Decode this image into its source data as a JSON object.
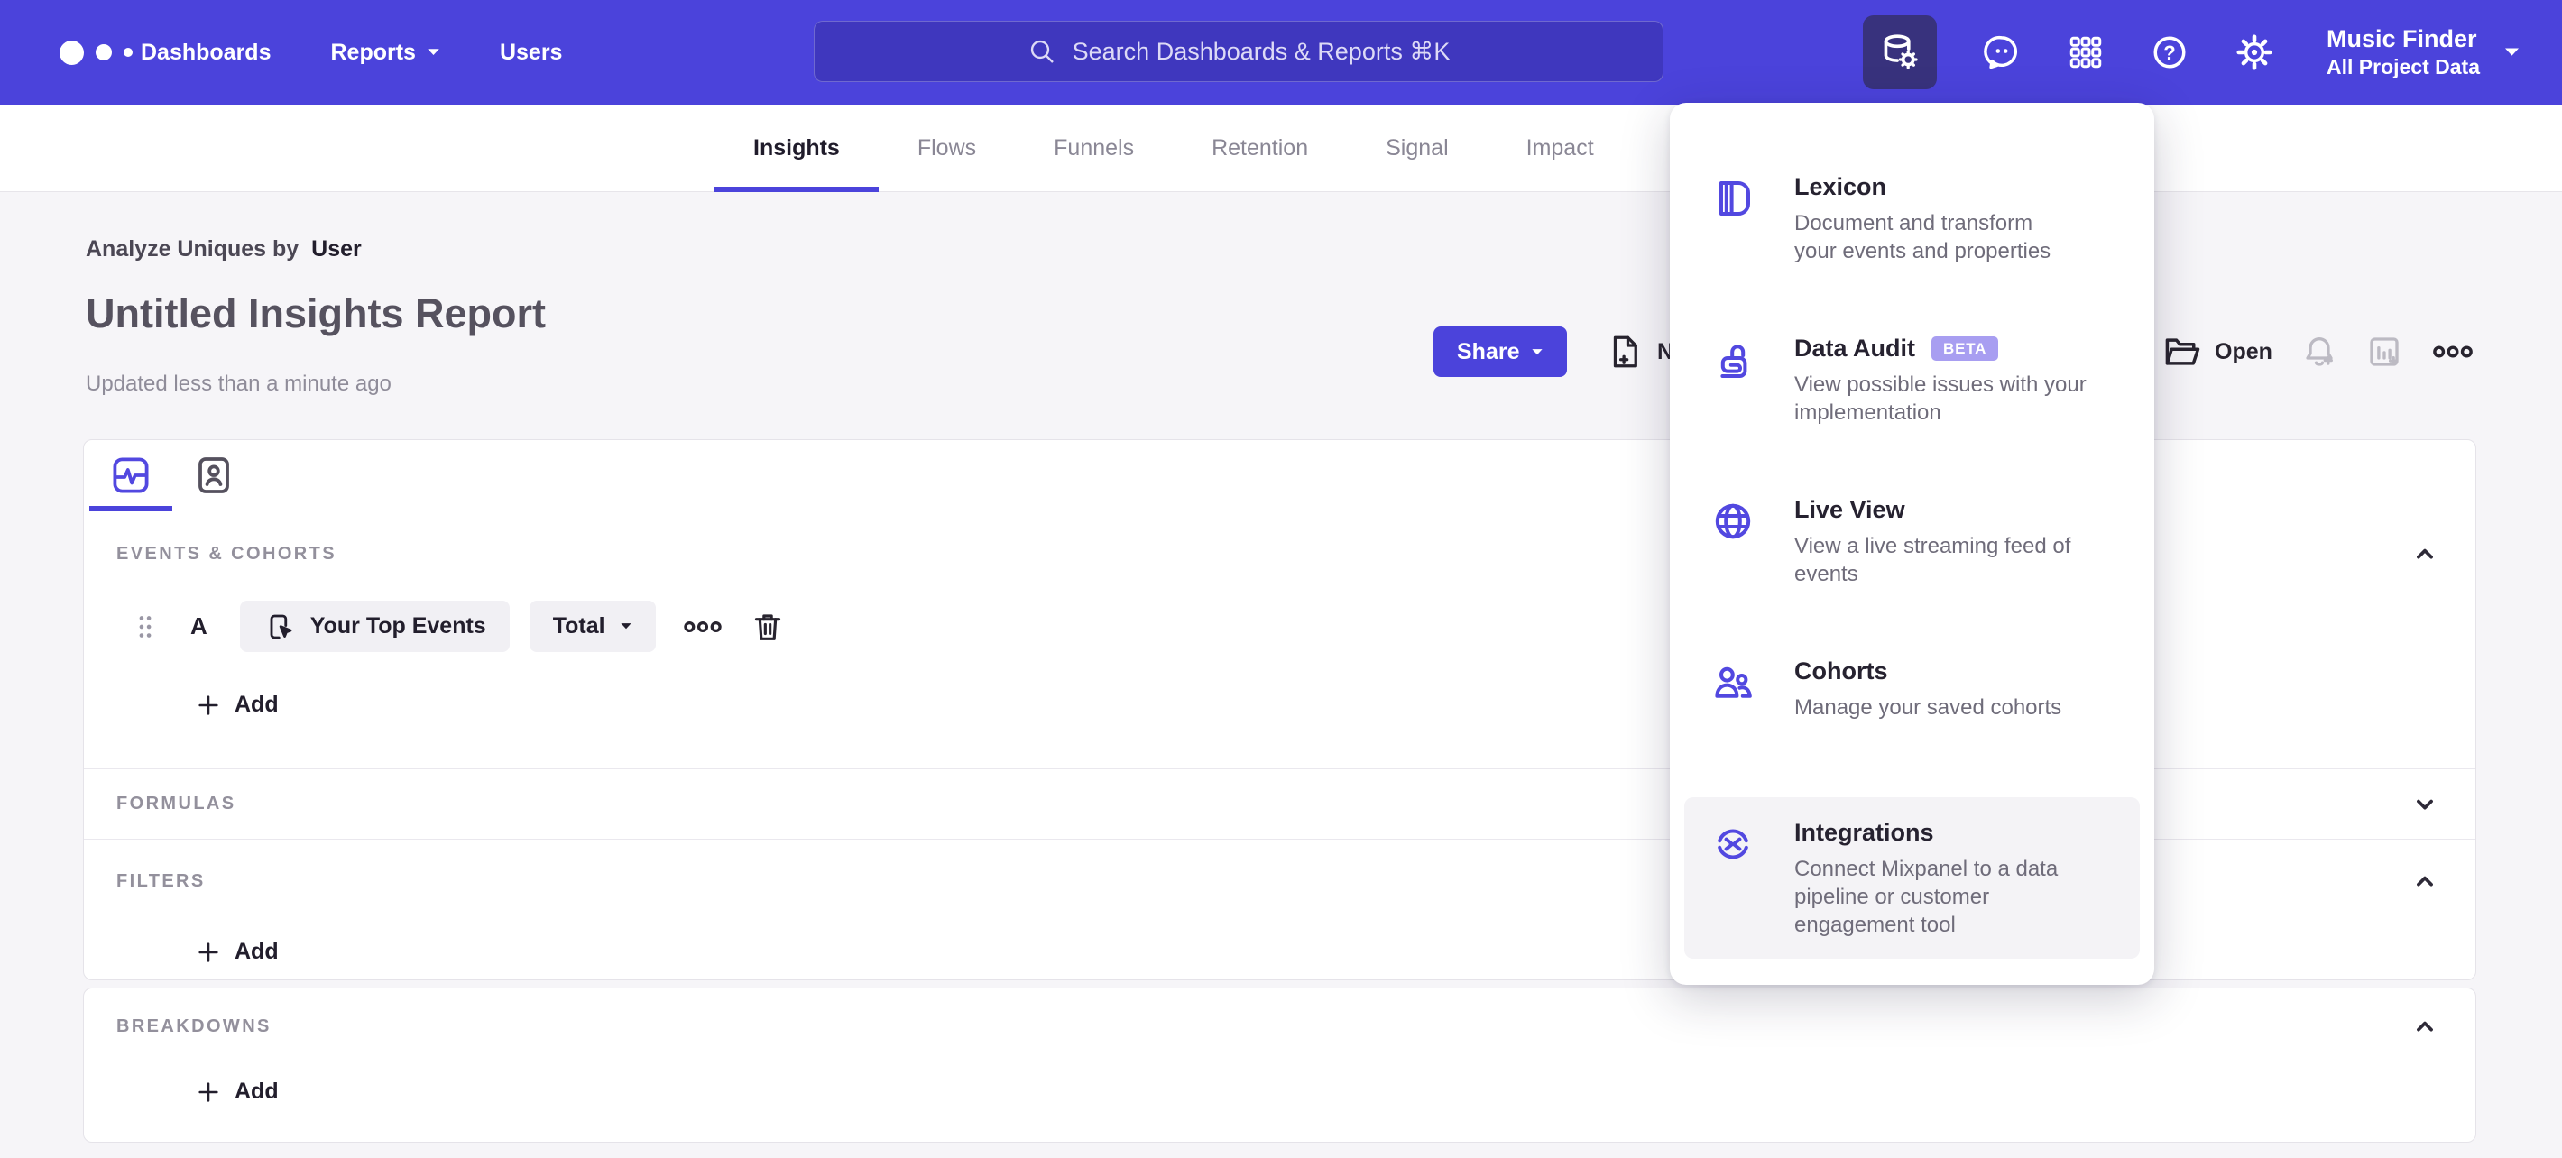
{
  "colors": {
    "accent": "#4B43DB",
    "accent_tile": "#38327D",
    "beta": "#A89EF1",
    "page_bg": "#F6F5F8",
    "card_border": "#E5E3E9",
    "text_dark": "#221E2C",
    "text_mid": "#56525F",
    "text_gray": "#8F8C99",
    "desc_gray": "#6F6C7A",
    "pill_bg": "#F1F0F4",
    "disabled_icon": "#BCBAC3",
    "hover_bg": "#F4F3F6"
  },
  "navbar": {
    "links": [
      {
        "label": "Dashboards"
      },
      {
        "label": "Reports"
      },
      {
        "label": "Users"
      }
    ],
    "search": {
      "placeholder": "Search Dashboards & Reports ⌘K"
    },
    "project": {
      "name": "Music Finder",
      "scope": "All Project Data"
    }
  },
  "tabs": {
    "items": [
      {
        "label": "Insights",
        "active": true
      },
      {
        "label": "Flows",
        "active": false
      },
      {
        "label": "Funnels",
        "active": false
      },
      {
        "label": "Retention",
        "active": false
      },
      {
        "label": "Signal",
        "active": false
      },
      {
        "label": "Impact",
        "active": false
      }
    ]
  },
  "header": {
    "breadcrumb_prefix": "Analyze Uniques by",
    "breadcrumb_value": "User",
    "title": "Untitled Insights Report",
    "updated": "Updated less than a minute ago",
    "share_label": "Share",
    "new_label": "New",
    "open_label": "Open"
  },
  "builder": {
    "events_label": "EVENTS & COHORTS",
    "formulas_label": "FORMULAS",
    "filters_label": "FILTERS",
    "breakdowns_label": "BREAKDOWNS",
    "row": {
      "series": "A",
      "event": "Your Top Events",
      "aggregation": "Total"
    },
    "add_label": "Add"
  },
  "menu": {
    "items": [
      {
        "title": "Lexicon",
        "desc": "Document and transform\nyour events and properties"
      },
      {
        "title": "Data Audit",
        "badge": "BETA",
        "desc": "View possible issues with your\nimplementation"
      },
      {
        "title": "Live View",
        "desc": "View a live streaming feed of\nevents"
      },
      {
        "title": "Cohorts",
        "desc": "Manage your saved cohorts"
      },
      {
        "title": "Integrations",
        "desc": "Connect Mixpanel to a data\npipeline or customer\nengagement tool"
      }
    ]
  }
}
